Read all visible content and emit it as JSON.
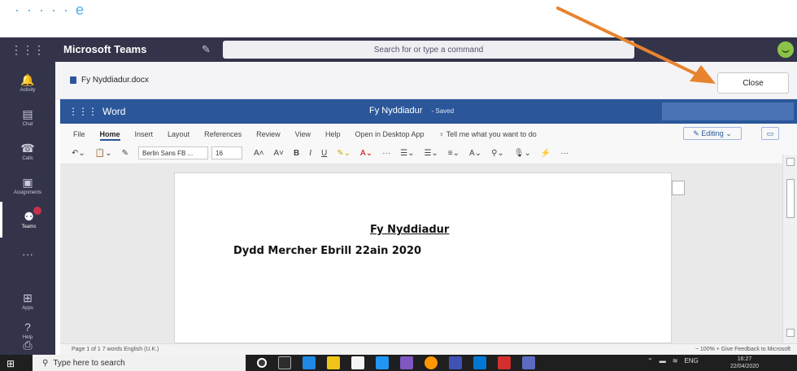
{
  "top_partial_text": "·  ·  ·  ·  ·  e",
  "teams": {
    "title": "Microsoft Teams",
    "compose_icon": "✎",
    "search_placeholder": "Search for or type a command"
  },
  "rail": [
    {
      "label": "Activity",
      "icon": "bell-icon",
      "glyph": "🔔"
    },
    {
      "label": "Chat",
      "icon": "chat-icon",
      "glyph": "▤"
    },
    {
      "label": "Calls",
      "icon": "phone-icon",
      "glyph": "☎"
    },
    {
      "label": "Assignments",
      "icon": "assignments-icon",
      "glyph": "▣"
    },
    {
      "label": "Teams",
      "icon": "teams-icon",
      "glyph": "⚉"
    },
    {
      "label": "···",
      "icon": "more-icon",
      "glyph": ""
    },
    {
      "label": "Apps",
      "icon": "apps-icon",
      "glyph": "⊞"
    },
    {
      "label": "Help",
      "icon": "help-icon",
      "glyph": "?"
    },
    {
      "label": "",
      "icon": "download-icon",
      "glyph": "⎙"
    }
  ],
  "doc_header": {
    "file_name": "Fy Nyddiadur.docx",
    "close_label": "Close"
  },
  "word": {
    "app_label": "Word",
    "doc_title": "Fy Nyddiadur",
    "saved": "-  Saved"
  },
  "ribbon": {
    "tabs": [
      "File",
      "Home",
      "Insert",
      "Layout",
      "References",
      "Review",
      "View",
      "Help",
      "Open in Desktop App",
      "♀  Tell me what you want to do"
    ],
    "editing_label": "✎ Editing ⌄",
    "font": "Berlin Sans FB ...",
    "size": "16"
  },
  "document": {
    "heading": "Fy Nyddiadur",
    "date_line": "Dydd Mercher Ebrill 22ain 2020"
  },
  "status": {
    "left": "Page 1 of 1      7 words      English (U.K.)",
    "right": "−  100%  +    Give Feedback to Microsoft"
  },
  "taskbar": {
    "search_placeholder": "Type here to search",
    "lang": "ENG",
    "time": "16:27",
    "date": "22/04/2020"
  },
  "colors": {
    "teams_dark": "#33344a",
    "word_blue": "#2b579a",
    "arrow_orange": "#e8832f"
  }
}
